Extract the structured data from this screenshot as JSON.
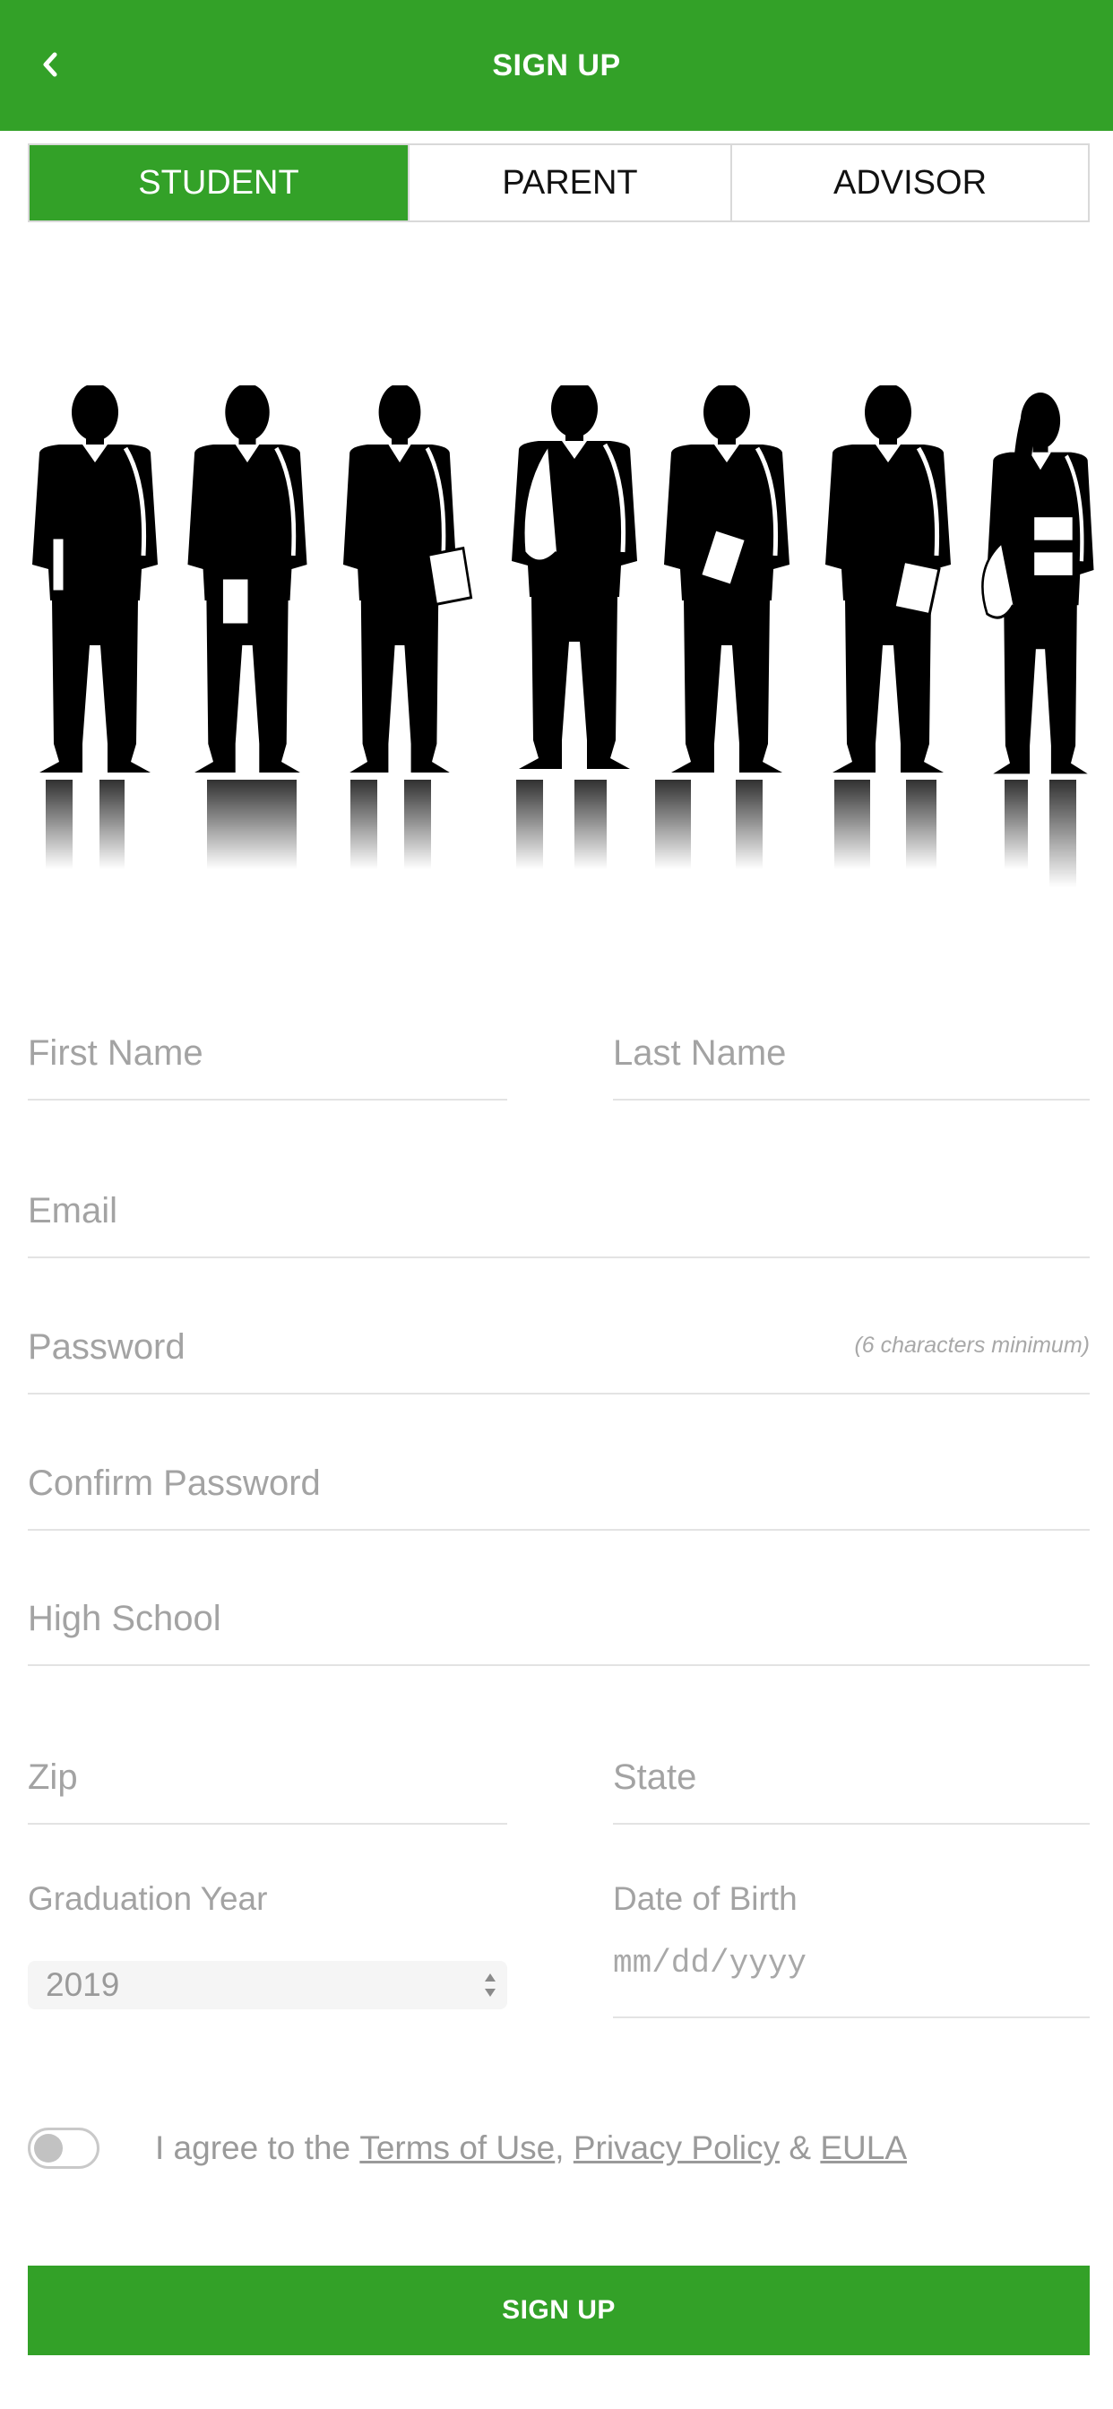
{
  "header": {
    "title": "SIGN UP",
    "bg_color": "#33a128",
    "back_icon": "chevron-left-icon"
  },
  "tabs": [
    {
      "label": "STUDENT",
      "active": true
    },
    {
      "label": "PARENT",
      "active": false
    },
    {
      "label": "ADVISOR",
      "active": false
    }
  ],
  "hero": {
    "description_icon": "students-silhouette-image"
  },
  "form": {
    "first_name": {
      "placeholder": "First Name",
      "value": ""
    },
    "last_name": {
      "placeholder": "Last Name",
      "value": ""
    },
    "email": {
      "placeholder": "Email",
      "value": ""
    },
    "password": {
      "placeholder": "Password",
      "value": "",
      "hint": "(6 characters minimum)"
    },
    "confirm_password": {
      "placeholder": "Confirm Password",
      "value": ""
    },
    "high_school": {
      "placeholder": "High School",
      "value": ""
    },
    "zip": {
      "placeholder": "Zip",
      "value": ""
    },
    "state": {
      "placeholder": "State",
      "value": ""
    },
    "graduation_year": {
      "label": "Graduation Year",
      "selected": "2019"
    },
    "date_of_birth": {
      "label": "Date of Birth",
      "placeholder": "mm/dd/yyyy"
    }
  },
  "terms": {
    "toggle_on": false,
    "prefix": "I agree to the",
    "terms_link": "Terms of Use",
    "comma": ",",
    "privacy_link": "Privacy Policy",
    "amp": "&",
    "eula_link": "EULA"
  },
  "signup_button": {
    "label": "SIGN UP"
  },
  "colors": {
    "accent": "#33a128",
    "placeholder": "#a3a3a3",
    "divider": "#e3e3e3"
  }
}
